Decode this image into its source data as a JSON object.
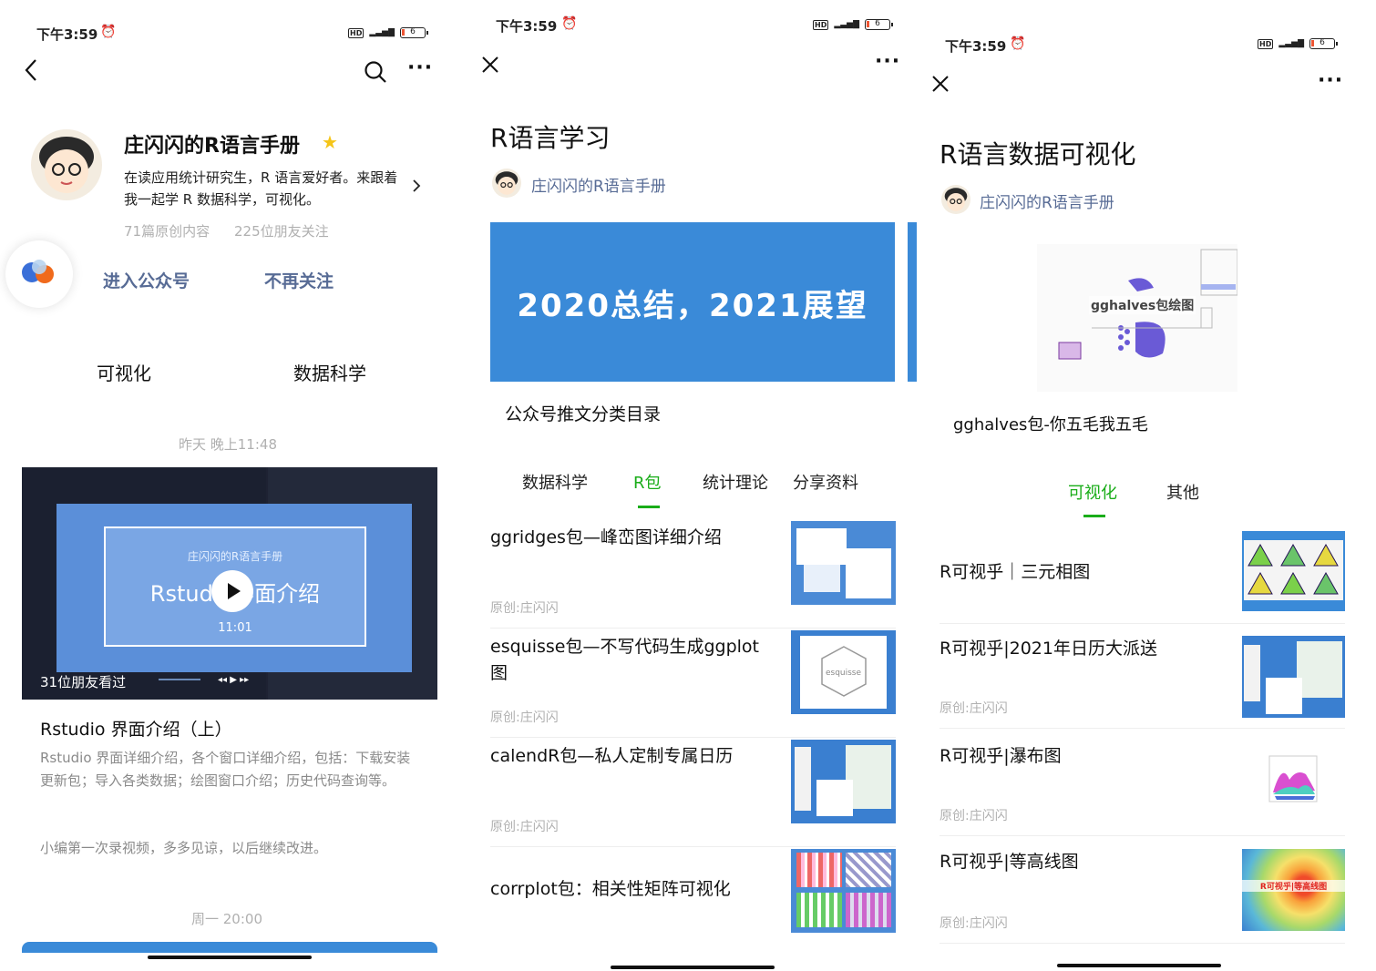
{
  "status": {
    "time": "下午3:59",
    "hd": "HD",
    "network": "4G",
    "battery": "6"
  },
  "p1": {
    "profile": {
      "name": "庄闪闪的R语言手册",
      "desc": "在读应用统计研究生，R 语言爱好者。来跟着我一起学 R 数据科学，可视化。",
      "original_count": "71篇原创内容",
      "followers": "225位朋友关注"
    },
    "actions": {
      "enter": "进入公众号",
      "unfollow": "不再关注"
    },
    "categories": [
      "可视化",
      "数据科学"
    ],
    "feed": {
      "timestamp1": "昨天 晚上11:48",
      "video_overlay_title": "庄闪闪的R语言手册",
      "video_overlay_subtitle": "Rstudio界面介绍",
      "video_duration": "11:01",
      "video_viewers": "31位朋友看过",
      "title": "Rstudio 界面介绍（上）",
      "body": "Rstudio 界面详细介绍，各个窗口详细介绍，包括：下载安装更新包；导入各类数据；绘图窗口介绍；历史代码查询等。",
      "note": "小编第一次录视频，多多见谅，以后继续改进。",
      "timestamp2": "周一 20:00"
    }
  },
  "p2": {
    "title": "R语言学习",
    "author": "庄闪闪的R语言手册",
    "banner_text": "2020总结，2021展望",
    "banner_caption": "公众号推文分类目录",
    "tabs": [
      "数据科学",
      "R包",
      "统计理论",
      "分享资料"
    ],
    "active_tab": "R包",
    "articles": [
      {
        "title": "ggridges包—峰峦图详细介绍",
        "meta": "原创:庄闪闪"
      },
      {
        "title": "esquisse包—不写代码生成ggplot图",
        "meta": "原创:庄闪闪",
        "thumb_label": "esquisse"
      },
      {
        "title": "calendR包—私人定制专属日历",
        "meta": "原创:庄闪闪"
      },
      {
        "title": "corrplot包：相关性矩阵可视化",
        "meta": ""
      }
    ]
  },
  "p3": {
    "title": "R语言数据可视化",
    "author": "庄闪闪的R语言手册",
    "hero_label": "gghalves包绘图",
    "hero_caption": "gghalves包-你五毛我五毛",
    "tabs": [
      "可视化",
      "其他"
    ],
    "active_tab": "可视化",
    "articles": [
      {
        "title": "R可视乎｜三元相图",
        "meta": ""
      },
      {
        "title": "R可视乎|2021年日历大派送",
        "meta": "原创:庄闪闪"
      },
      {
        "title": "R可视乎|瀑布图",
        "meta": "原创:庄闪闪"
      },
      {
        "title": "R可视乎|等高线图",
        "meta": "原创:庄闪闪",
        "thumb_label": "R可视乎|等高线图"
      }
    ]
  },
  "colors": {
    "accent_green": "#1aad19",
    "link_blue": "#576b95",
    "banner_blue": "#3a8ad8"
  }
}
